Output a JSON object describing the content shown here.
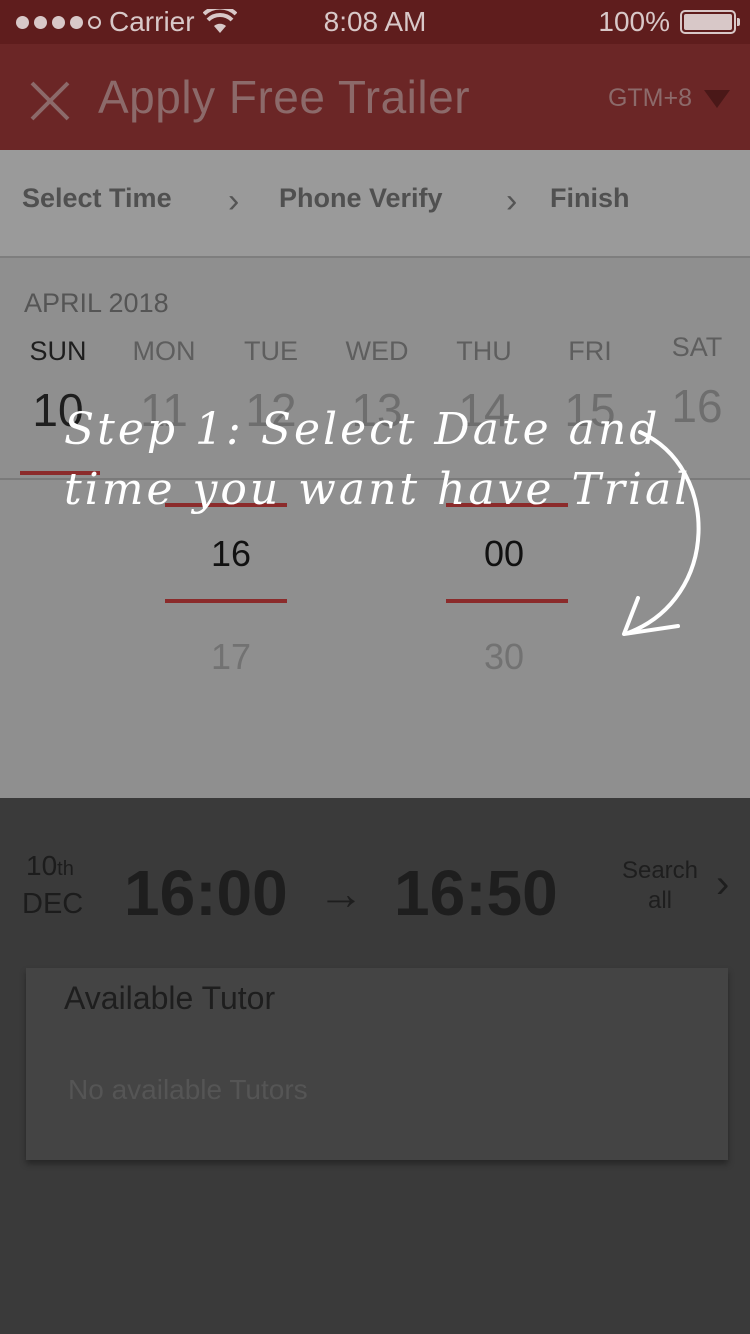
{
  "status": {
    "carrier": "Carrier",
    "time": "8:08 AM",
    "battery": "100%"
  },
  "header": {
    "title": "Apply Free Trailer",
    "timezone": "GTM+8"
  },
  "steps": [
    "Select Time",
    "Phone Verify",
    "Finish"
  ],
  "calendar": {
    "month": "APRIL 2018",
    "days": [
      {
        "name": "SUN",
        "date": "10"
      },
      {
        "name": "MON",
        "date": "11"
      },
      {
        "name": "TUE",
        "date": "12"
      },
      {
        "name": "WED",
        "date": "13"
      },
      {
        "name": "THU",
        "date": "14"
      },
      {
        "name": "FRI",
        "date": "15"
      },
      {
        "name": "SAT",
        "date": "16"
      }
    ]
  },
  "picker": {
    "hour": "16",
    "hour_next": "17",
    "minute": "00",
    "minute_next": "30"
  },
  "note": {
    "line1": "Step 1: Select Date and",
    "line2": "time you want have Trial"
  },
  "summary": {
    "day": "10",
    "day_suffix": "th",
    "month": "DEC",
    "start": "16:00",
    "arrow": "→",
    "end": "16:50",
    "search_line1": "Search",
    "search_line2": "all"
  },
  "tutor": {
    "title": "Available Tutor",
    "empty": "No available Tutors"
  }
}
